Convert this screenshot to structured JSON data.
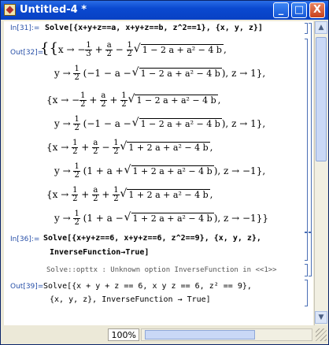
{
  "window": {
    "title": "Untitled-4 *",
    "min_label": "_",
    "max_label": "□",
    "close_label": "X"
  },
  "cells": {
    "in31_label": "In[31]:=",
    "in31_code": "Solve[{x+y+z==a, x+y+z==b, z^2==1}, {x, y, z}]",
    "out32_label": "Out[32]=",
    "sol1_x_a": "a",
    "sol1_x_frac1_num": "1",
    "sol1_x_frac1_den": "3",
    "sol1_rad": "1 − 2 a + a² − 4 b",
    "sol1_y_paren": "−1 − a − ",
    "sol1_y_rad": "1 − 2 a + a² − 4 b",
    "sol1_z": "z → 1},",
    "sol2_rad": "1 − 2 a + a² − 4 b",
    "sol2_y_paren": "−1 − a − ",
    "sol2_y_rad": "1 − 2 a + a² − 4 b",
    "sol2_z": "z → 1},",
    "sol3_rad": "1 + 2 a + a² − 4 b",
    "sol3_y_paren": "1 + a + ",
    "sol3_y_rad": "1 + 2 a + a² − 4 b",
    "sol3_z": "z → −1},",
    "sol4_rad": "1 + 2 a + a² − 4 b",
    "sol4_y_paren": "1 + a − ",
    "sol4_y_rad": "1 + 2 a + a² − 4 b",
    "sol4_z": "z → −1}}",
    "in36_label": "In[36]:=",
    "in36_code_line1": "Solve[{x+y+z==6, x+y+z==6, z^2==9}, {x, y, z},",
    "in36_code_line2": "InverseFunction→True]",
    "msg36": "Solve::opttx : Unknown option InverseFunction in <<1>>",
    "in39_label": "Out[39]=",
    "in39_line1": "Solve[{x + y + z == 6, x y z == 6, z² == 9},",
    "in39_line2": "{x, y, z}, InverseFunction → True]"
  },
  "status": {
    "zoom": "100%"
  },
  "icons": {
    "app": "mathematica-notebook-icon",
    "scroll_up": "arrow-up-icon",
    "scroll_down": "arrow-down-icon"
  }
}
